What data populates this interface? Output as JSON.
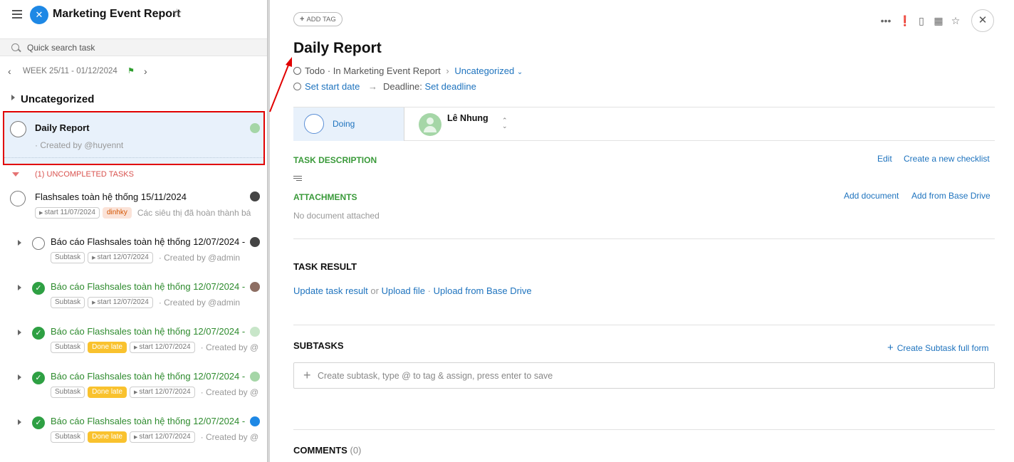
{
  "header": {
    "app_title": "Marketing Event Report",
    "logo_glyph": "✕"
  },
  "search": {
    "placeholder": "Quick search task"
  },
  "week": {
    "label": "WEEK 25/11 - 01/12/2024"
  },
  "group": {
    "name": "Uncategorized"
  },
  "selected_task": {
    "title": "Daily Report",
    "meta": "· Created by @huyennt"
  },
  "uncompleted": {
    "label": "(1) UNCOMPLETED TASKS"
  },
  "tasks": [
    {
      "title": "Flashsales toàn hệ thống 15/11/2024",
      "tags": [
        "start 11/07/2024",
        "dinhky"
      ],
      "meta": "Các siêu thị đã hoàn thành bá",
      "done": false
    },
    {
      "title": "Báo cáo Flashsales toàn hệ thống 12/07/2024 -",
      "tags": [
        "Subtask",
        "start 12/07/2024"
      ],
      "meta": "· Created by @admin",
      "done": false
    },
    {
      "title": "Báo cáo Flashsales toàn hệ thống 12/07/2024 -",
      "tags": [
        "Subtask",
        "start 12/07/2024"
      ],
      "meta": "· Created by @admin",
      "done": true
    },
    {
      "title": "Báo cáo Flashsales toàn hệ thống 12/07/2024 -",
      "tags": [
        "Subtask",
        "Done late",
        "start 12/07/2024"
      ],
      "meta": "· Created by @",
      "done": true
    },
    {
      "title": "Báo cáo Flashsales toàn hệ thống 12/07/2024 -",
      "tags": [
        "Subtask",
        "Done late",
        "start 12/07/2024"
      ],
      "meta": "· Created by @",
      "done": true
    },
    {
      "title": "Báo cáo Flashsales toàn hệ thống 12/07/2024 -",
      "tags": [
        "Subtask",
        "Done late",
        "start 12/07/2024"
      ],
      "meta": "· Created by @",
      "done": true
    }
  ],
  "detail": {
    "add_tag": "ADD TAG",
    "title": "Daily Report",
    "status": "Todo",
    "location": "· In Marketing Event Report",
    "category": "Uncategorized",
    "start_date": "Set start date",
    "deadline_label": "Deadline:",
    "deadline": "Set deadline",
    "stage": "Doing",
    "assignee": "Lê Nhung",
    "task_description": "TASK DESCRIPTION",
    "edit": "Edit",
    "create_checklist": "Create a new checklist",
    "attachments": "ATTACHMENTS",
    "add_document": "Add document",
    "add_from_drive": "Add from Base Drive",
    "no_document": "No document attached",
    "task_result": "TASK RESULT",
    "update_result": "Update task result",
    "or": " or ",
    "upload_file": "Upload file",
    "sep": " · ",
    "upload_drive": "Upload from Base Drive",
    "subtasks": "SUBTASKS",
    "create_subtask_full": "Create Subtask full form",
    "subtask_placeholder": "Create subtask, type @ to tag & assign, press enter to save",
    "comments": "COMMENTS",
    "comments_count": "0"
  },
  "colors": {
    "accent": "#1e73be",
    "done": "#2ea043",
    "late": "#f9c22e",
    "highlight": "#e10000",
    "section": "#3a9a3a"
  }
}
